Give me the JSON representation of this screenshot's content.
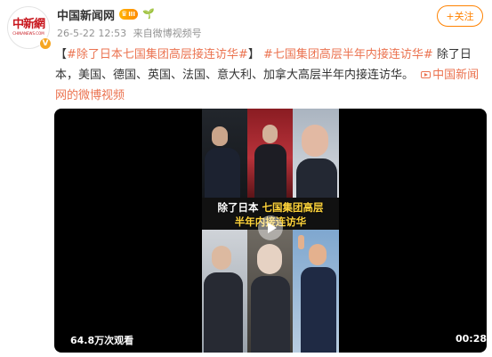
{
  "account": {
    "avatar_text_cn": "中新網",
    "avatar_text_en": "CHINANEWS.COM",
    "verified_mark": "V",
    "name": "中国新闻网",
    "vip_level": "III"
  },
  "meta": {
    "date": "26-5-22 12:53",
    "source_prefix": "来自",
    "source": "微博视频号"
  },
  "follow_button": "+关注",
  "post": {
    "bracket_open": "【",
    "topic1": "#除了日本七国集团高层接连访华#",
    "bracket_close": "】",
    "topic2": "#七国集团高层半年内接连访华#",
    "body": "除了日本，美国、德国、英国、法国、意大利、加拿大高层半年内接连访华。",
    "video_link": "中国新闻网的微博视频"
  },
  "video": {
    "caption_line1_white": "除了日本 ",
    "caption_line1_yellow": "七国集团高层",
    "caption_line2": "半年内接连访华",
    "views": "64.8万次观看",
    "duration": "00:28"
  },
  "colors": {
    "link": "#eb7350",
    "follow": "#ff8200",
    "caption_yellow": "#ffd43b"
  },
  "icons": {
    "vip": "crown-icon",
    "sprout": "sprout-icon",
    "video_link": "video-link-icon",
    "play": "play-icon"
  }
}
